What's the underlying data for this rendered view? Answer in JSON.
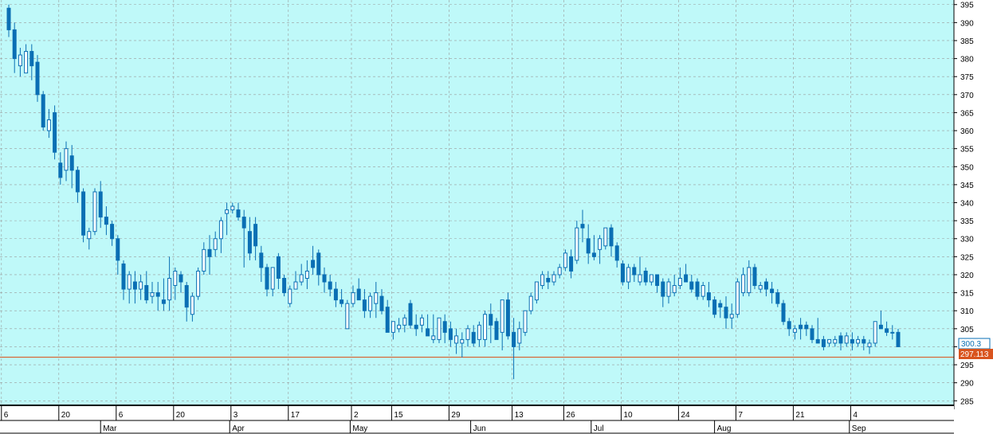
{
  "chart_data": {
    "type": "candlestick",
    "title": "",
    "xlabel": "",
    "ylabel": "",
    "ylim": [
      282,
      396
    ],
    "grid": true,
    "y_ticks": [
      285,
      290,
      295,
      300,
      305,
      310,
      315,
      320,
      325,
      330,
      335,
      340,
      345,
      350,
      355,
      360,
      365,
      370,
      375,
      380,
      385,
      390,
      395
    ],
    "x_day_ticks": [
      {
        "label": "6",
        "bar": -1
      },
      {
        "label": "20",
        "bar": 9
      },
      {
        "label": "6",
        "bar": 19
      },
      {
        "label": "20",
        "bar": 29
      },
      {
        "label": "3",
        "bar": 39
      },
      {
        "label": "17",
        "bar": 49
      },
      {
        "label": "2",
        "bar": 60
      },
      {
        "label": "15",
        "bar": 67
      },
      {
        "label": "29",
        "bar": 77
      },
      {
        "label": "13",
        "bar": 88
      },
      {
        "label": "26",
        "bar": 97
      },
      {
        "label": "10",
        "bar": 107
      },
      {
        "label": "24",
        "bar": 117
      },
      {
        "label": "7",
        "bar": 127
      },
      {
        "label": "21",
        "bar": 137
      },
      {
        "label": "4",
        "bar": 147
      }
    ],
    "x_month_ticks": [
      {
        "label": "Mar",
        "bar": 16
      },
      {
        "label": "Apr",
        "bar": 38.5
      },
      {
        "label": "May",
        "bar": 59.5
      },
      {
        "label": "Jun",
        "bar": 80.5
      },
      {
        "label": "Jul",
        "bar": 101.5
      },
      {
        "label": "Aug",
        "bar": 123
      },
      {
        "label": "Sep",
        "bar": 146.5
      }
    ],
    "last_close_label": "300.3",
    "reference_line": {
      "value": 297.113,
      "label": "297.113",
      "color": "#d9541e"
    },
    "colors": {
      "background": "#bff9f9",
      "up": "#ffffff",
      "down": "#0a6fb4",
      "wick": "#0a6fb4",
      "grid": "#9a9a9a"
    },
    "ohlc": [
      [
        394,
        395,
        386,
        388
      ],
      [
        388,
        390,
        376,
        380
      ],
      [
        378,
        383,
        375,
        381
      ],
      [
        376,
        384,
        377,
        382
      ],
      [
        382,
        384,
        374,
        378
      ],
      [
        379,
        381,
        368,
        370
      ],
      [
        370,
        371,
        360,
        361
      ],
      [
        360,
        366,
        358,
        363
      ],
      [
        365,
        367,
        352,
        354
      ],
      [
        351,
        354,
        345,
        347
      ],
      [
        349,
        357,
        346,
        355
      ],
      [
        353,
        356,
        344,
        349
      ],
      [
        349,
        350,
        340,
        343
      ],
      [
        343,
        344,
        329,
        331
      ],
      [
        330,
        333,
        327,
        332
      ],
      [
        332,
        344,
        331,
        343
      ],
      [
        343,
        346,
        333,
        336
      ],
      [
        336,
        339,
        331,
        334
      ],
      [
        334,
        335,
        328,
        330
      ],
      [
        330,
        331,
        320,
        324
      ],
      [
        323,
        324,
        313,
        316
      ],
      [
        316,
        321,
        312,
        320
      ],
      [
        318,
        321,
        312,
        316
      ],
      [
        316,
        320,
        313,
        318
      ],
      [
        317,
        321,
        312,
        313
      ],
      [
        314,
        318,
        312,
        315
      ],
      [
        315,
        318,
        310,
        314
      ],
      [
        313,
        319,
        310,
        312
      ],
      [
        313,
        325,
        310,
        319
      ],
      [
        317,
        322,
        313,
        321
      ],
      [
        320,
        321,
        315,
        318
      ],
      [
        317,
        318,
        307,
        311
      ],
      [
        309,
        315,
        307,
        314
      ],
      [
        314,
        322,
        313,
        321
      ],
      [
        321,
        329,
        320,
        327
      ],
      [
        327,
        331,
        320,
        325
      ],
      [
        327,
        332,
        325,
        330
      ],
      [
        330,
        336,
        326,
        335
      ],
      [
        337,
        340,
        331,
        338
      ],
      [
        338,
        340,
        337,
        339
      ],
      [
        338,
        340,
        335,
        336
      ],
      [
        336,
        338,
        322,
        333
      ],
      [
        332,
        336,
        324,
        326
      ],
      [
        334,
        336,
        324,
        328
      ],
      [
        326,
        328,
        318,
        322
      ],
      [
        322,
        323,
        314,
        316
      ],
      [
        316,
        320,
        314,
        322
      ],
      [
        325,
        326,
        316,
        319
      ],
      [
        319,
        320,
        314,
        315
      ],
      [
        312,
        317,
        311,
        316
      ],
      [
        316,
        321,
        316,
        318
      ],
      [
        318,
        323,
        317,
        320
      ],
      [
        319,
        324,
        316,
        321
      ],
      [
        324,
        328,
        320,
        322
      ],
      [
        326,
        327,
        317,
        320
      ],
      [
        320,
        322,
        315,
        318
      ],
      [
        318,
        320,
        314,
        316
      ],
      [
        316,
        318,
        311,
        313
      ],
      [
        313,
        316,
        311,
        312
      ],
      [
        305,
        313,
        305,
        312
      ],
      [
        312,
        317,
        311,
        315
      ],
      [
        316,
        319,
        313,
        313
      ],
      [
        313,
        316,
        308,
        310
      ],
      [
        310,
        315,
        308,
        314
      ],
      [
        312,
        318,
        308,
        315
      ],
      [
        314,
        316,
        309,
        310
      ],
      [
        311,
        313,
        305,
        304
      ],
      [
        304,
        307,
        302,
        307
      ],
      [
        305,
        308,
        304,
        306
      ],
      [
        306,
        309,
        304,
        308
      ],
      [
        312,
        313,
        305,
        306
      ],
      [
        306,
        309,
        303,
        305
      ],
      [
        306,
        309,
        304,
        308
      ],
      [
        305,
        309,
        304,
        303
      ],
      [
        302,
        309,
        301,
        303
      ],
      [
        302,
        306,
        301,
        308
      ],
      [
        307,
        309,
        301,
        304
      ],
      [
        305,
        307,
        300,
        302
      ],
      [
        301,
        305,
        298,
        303
      ],
      [
        301,
        304,
        297,
        302
      ],
      [
        302,
        306,
        300,
        305
      ],
      [
        304,
        306,
        300,
        301
      ],
      [
        302,
        307,
        300,
        306
      ],
      [
        302,
        310,
        300,
        309
      ],
      [
        309,
        312,
        301,
        306
      ],
      [
        307,
        308,
        302,
        302
      ],
      [
        304,
        313,
        299,
        313
      ],
      [
        313,
        315,
        302,
        303
      ],
      [
        304,
        308,
        291,
        300
      ],
      [
        301,
        307,
        299,
        305
      ],
      [
        304,
        310,
        303,
        310
      ],
      [
        310,
        315,
        309,
        314
      ],
      [
        313,
        318,
        312,
        318
      ],
      [
        317,
        321,
        316,
        320
      ],
      [
        319,
        321,
        316,
        318
      ],
      [
        318,
        321,
        317,
        320
      ],
      [
        320,
        323,
        319,
        322
      ],
      [
        322,
        327,
        321,
        326
      ],
      [
        325,
        327,
        319,
        321
      ],
      [
        324,
        335,
        323,
        333
      ],
      [
        334,
        338,
        329,
        333
      ],
      [
        330,
        334,
        323,
        326
      ],
      [
        326,
        331,
        324,
        325
      ],
      [
        327,
        331,
        323,
        330
      ],
      [
        328,
        333,
        327,
        333
      ],
      [
        333,
        334,
        325,
        328
      ],
      [
        328,
        329,
        322,
        324
      ],
      [
        323,
        324,
        317,
        318
      ],
      [
        318,
        323,
        316,
        322
      ],
      [
        322,
        323,
        318,
        320
      ],
      [
        318,
        325,
        317,
        320
      ],
      [
        321,
        322,
        317,
        318
      ],
      [
        318,
        320,
        317,
        320
      ],
      [
        320,
        320,
        315,
        317
      ],
      [
        318,
        319,
        311,
        314
      ],
      [
        314,
        319,
        312,
        318
      ],
      [
        315,
        320,
        314,
        317
      ],
      [
        317,
        322,
        316,
        319
      ],
      [
        320,
        323,
        318,
        318
      ],
      [
        318,
        320,
        315,
        316
      ],
      [
        318,
        319,
        313,
        314
      ],
      [
        314,
        318,
        313,
        317
      ],
      [
        315,
        318,
        311,
        313
      ],
      [
        313,
        314,
        308,
        309
      ],
      [
        312,
        313,
        308,
        311
      ],
      [
        311,
        314,
        305,
        308
      ],
      [
        308,
        312,
        305,
        309
      ],
      [
        309,
        319,
        308,
        318
      ],
      [
        315,
        322,
        314,
        320
      ],
      [
        315,
        324,
        314,
        322
      ],
      [
        322,
        323,
        316,
        317
      ],
      [
        316,
        318,
        315,
        317
      ],
      [
        318,
        319,
        314,
        316
      ],
      [
        316,
        318,
        312,
        315
      ],
      [
        315,
        316,
        311,
        312
      ],
      [
        312,
        313,
        306,
        307
      ],
      [
        307,
        308,
        303,
        305
      ],
      [
        304,
        306,
        302,
        305
      ],
      [
        306,
        308,
        302,
        305
      ],
      [
        306,
        307,
        303,
        305
      ],
      [
        305,
        306,
        301,
        302
      ],
      [
        302,
        308,
        301,
        301
      ],
      [
        302,
        303,
        299,
        300
      ],
      [
        301,
        302,
        300,
        302
      ],
      [
        301,
        303,
        300,
        302
      ],
      [
        303,
        304,
        299,
        301
      ],
      [
        301,
        304,
        300,
        303
      ],
      [
        302,
        304,
        299,
        301
      ],
      [
        301,
        303,
        300,
        302
      ],
      [
        302,
        303,
        299,
        301
      ],
      [
        300,
        302,
        298,
        301
      ],
      [
        301,
        307,
        300,
        307
      ],
      [
        306,
        310,
        305,
        305
      ],
      [
        305,
        307,
        303,
        304
      ],
      [
        304,
        306,
        302,
        304
      ],
      [
        304,
        305,
        300,
        300
      ]
    ]
  }
}
